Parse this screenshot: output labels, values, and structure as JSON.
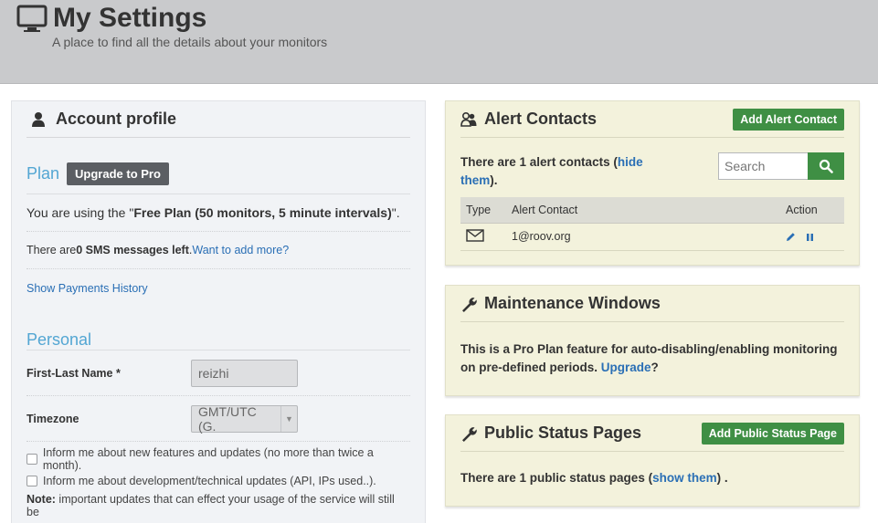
{
  "header": {
    "title": "My Settings",
    "subtitle": "A place to find all the details about your monitors"
  },
  "account": {
    "title": "Account profile",
    "plan": {
      "section_title": "Plan",
      "upgrade_label": "Upgrade to Pro",
      "using_prefix": "You are using the \"",
      "plan_name": "Free Plan (50 monitors, 5 minute intervals)",
      "using_suffix": "\".",
      "sms_prefix": "There are ",
      "sms_count": "0 SMS messages left",
      "sms_suffix": ". ",
      "sms_link": "Want to add more?",
      "history_link": "Show Payments History"
    },
    "personal": {
      "section_title": "Personal",
      "name_label": "First-Last Name *",
      "name_value": "reizhi",
      "timezone_label": "Timezone",
      "timezone_value": "GMT/UTC (G.",
      "check_features": "Inform me about new features and updates (no more than twice a month).",
      "check_dev": "Inform me about development/technical updates (API, IPs used..).",
      "note_label": "Note:",
      "note_text": " important updates that can effect your usage of the service will still be"
    }
  },
  "alerts": {
    "title": "Alert Contacts",
    "add_label": "Add Alert Contact",
    "text_prefix": "There are 1 alert contacts (",
    "hide_link": "hide them",
    "text_suffix": ").",
    "search_placeholder": "Search",
    "columns": [
      "Type",
      "Alert Contact",
      "Action"
    ],
    "rows": [
      {
        "type_icon": "envelope-icon",
        "contact": "1@roov.org"
      }
    ]
  },
  "maintenance": {
    "title": "Maintenance Windows",
    "text": "This is a Pro Plan feature for auto-disabling/enabling monitoring on pre-defined periods. ",
    "upgrade_link": "Upgrade",
    "text_suffix": "?"
  },
  "status_pages": {
    "title": "Public Status Pages",
    "add_label": "Add Public Status Page",
    "text_prefix": "There are 1 public status pages (",
    "show_link": "show them",
    "text_suffix": ") ."
  },
  "colors": {
    "topbar": "#c9cacc",
    "accent_blue": "#53a6d3",
    "link": "#2a6fb5",
    "green_button": "#3f8f44",
    "dark_button": "#5b5e63",
    "card_bg": "#f3f2dc",
    "panel_bg": "#f1f3f6"
  }
}
